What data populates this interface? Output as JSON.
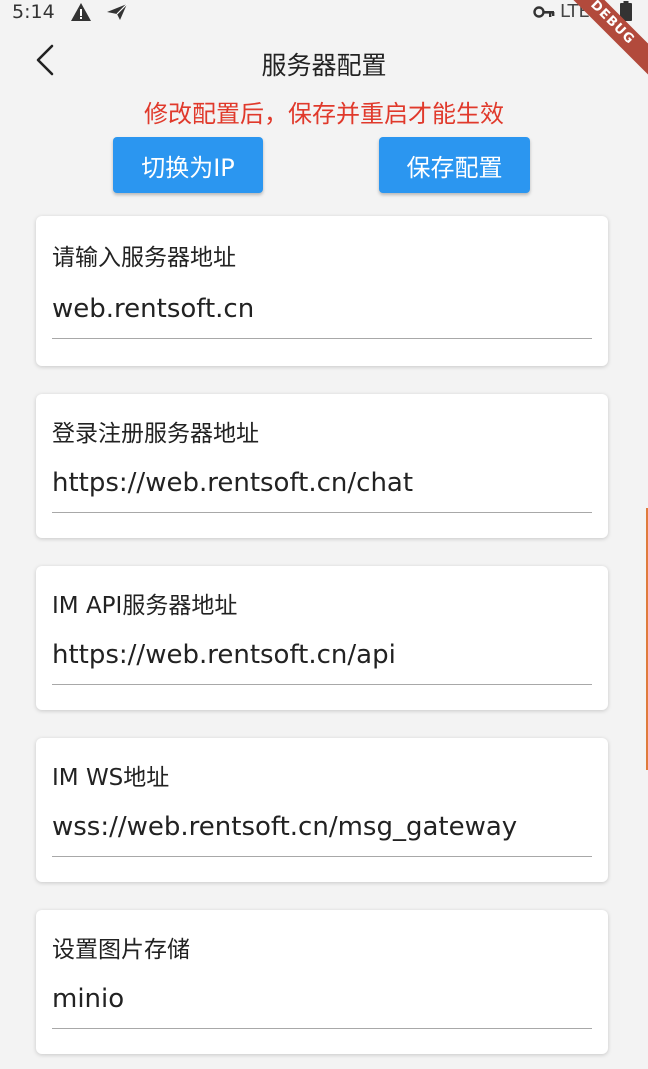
{
  "status_bar": {
    "time": "5:14",
    "network": "LTE",
    "icons": [
      "warning-icon",
      "send-icon",
      "key-icon",
      "battery-icon"
    ]
  },
  "debug_banner": "DEBUG",
  "app_bar": {
    "title": "服务器配置",
    "back_icon": "chevron-left-icon"
  },
  "notice": "修改配置后，保存并重启才能生效",
  "actions": {
    "switch_label": "切换为IP",
    "save_label": "保存配置",
    "accent_color": "#2b96f0"
  },
  "fields": [
    {
      "label": "请输入服务器地址",
      "value": "web.rentsoft.cn"
    },
    {
      "label": "登录注册服务器地址",
      "value": "https://web.rentsoft.cn/chat"
    },
    {
      "label": "IM API服务器地址",
      "value": "https://web.rentsoft.cn/api"
    },
    {
      "label": "IM WS地址",
      "value": "wss://web.rentsoft.cn/msg_gateway"
    },
    {
      "label": "设置图片存储",
      "value": "minio"
    }
  ],
  "colors": {
    "notice": "#e0392b",
    "debug_banner": "#b24a3c"
  }
}
